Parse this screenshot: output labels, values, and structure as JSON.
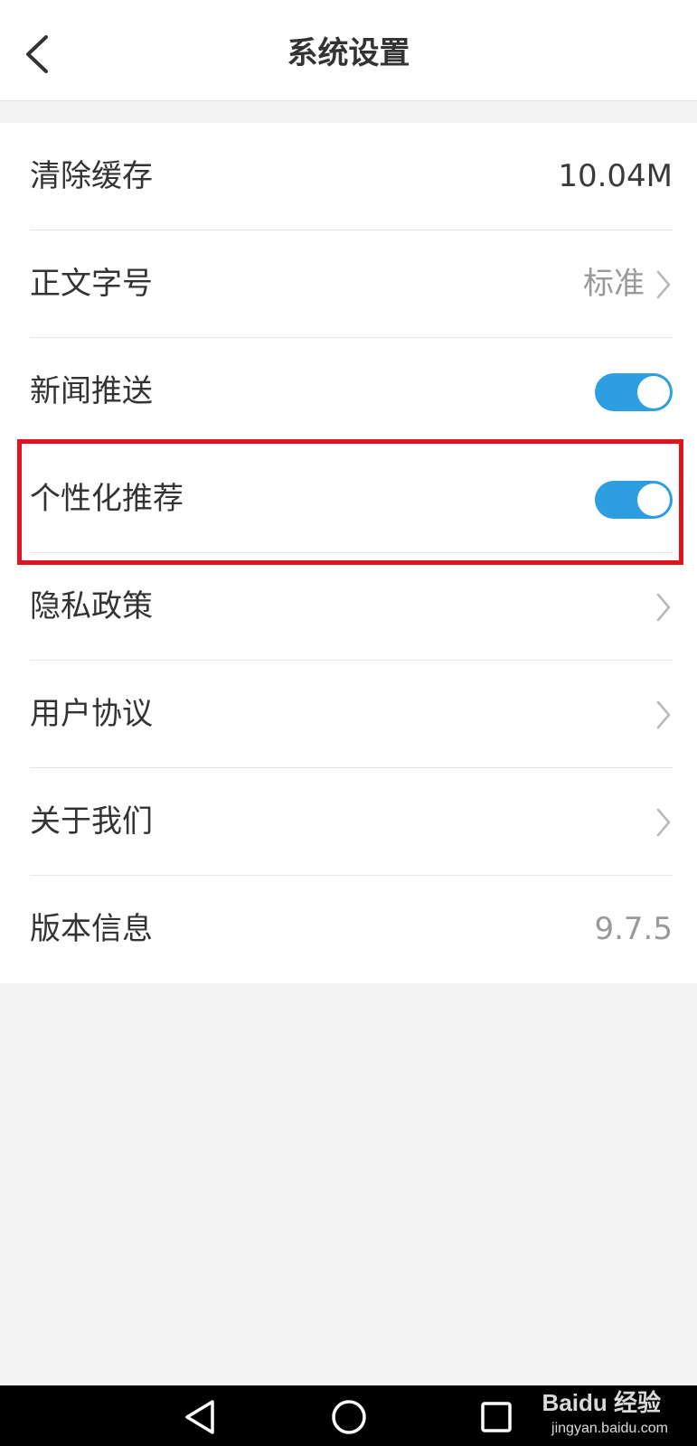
{
  "header": {
    "title": "系统设置"
  },
  "settings": {
    "cache": {
      "label": "清除缓存",
      "value": "10.04M"
    },
    "font_size": {
      "label": "正文字号",
      "value": "标准"
    },
    "news_push": {
      "label": "新闻推送",
      "enabled": true
    },
    "personalized": {
      "label": "个性化推荐",
      "enabled": true
    },
    "privacy": {
      "label": "隐私政策"
    },
    "agreement": {
      "label": "用户协议"
    },
    "about": {
      "label": "关于我们"
    },
    "version": {
      "label": "版本信息",
      "value": "9.7.5"
    }
  },
  "watermark": {
    "brand": "Baidu 经验",
    "url": "jingyan.baidu.com"
  },
  "colors": {
    "accent": "#2d9ee0",
    "highlight": "#e0141e"
  },
  "icons": [
    "back-arrow-icon",
    "chevron-right-icon",
    "nav-back-icon",
    "nav-home-icon",
    "nav-recents-icon"
  ]
}
